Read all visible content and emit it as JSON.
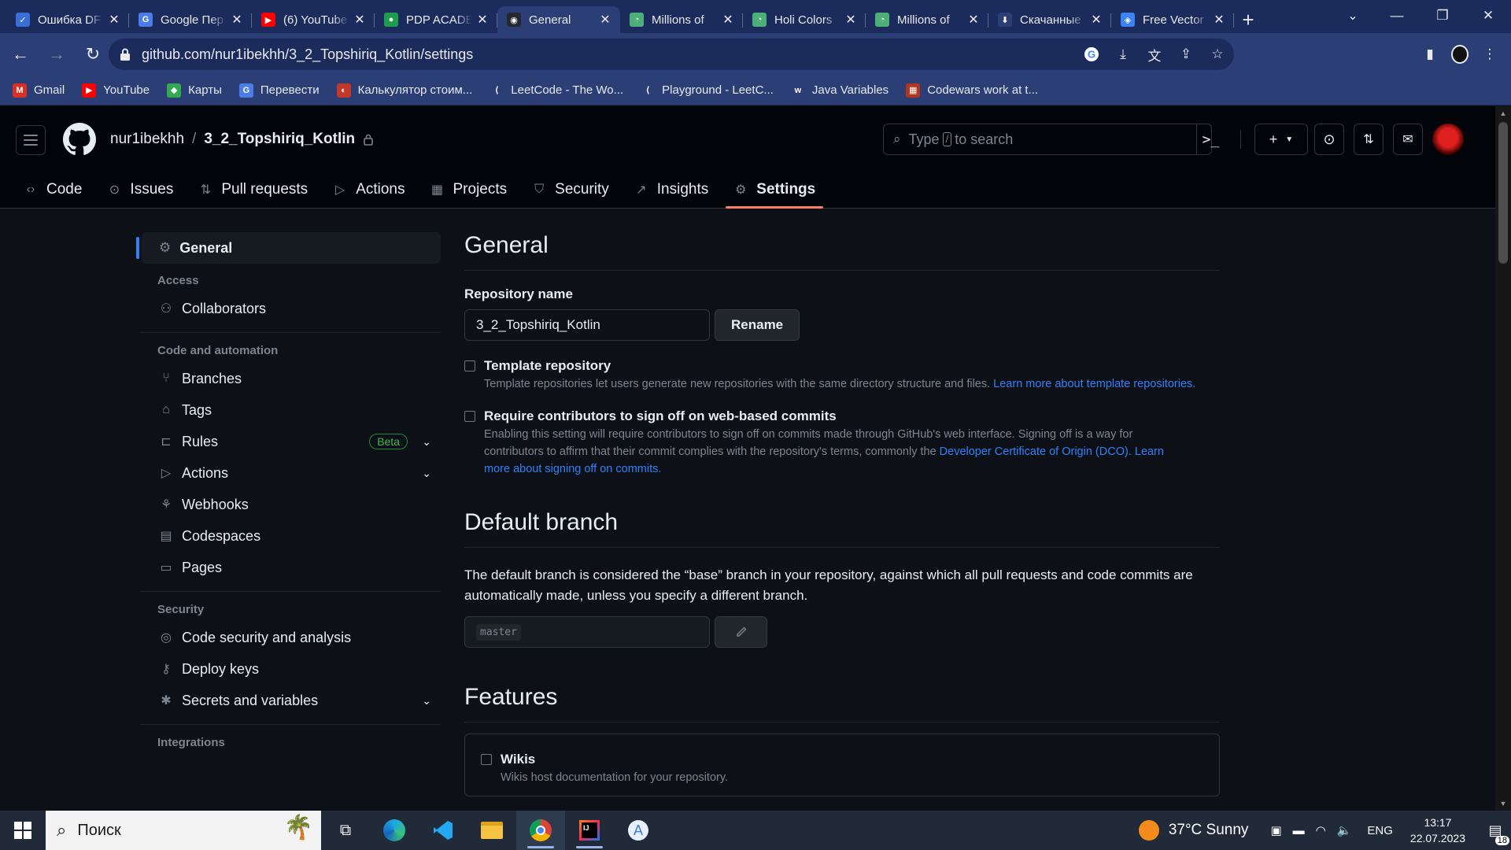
{
  "browser": {
    "tabs": [
      {
        "label": "Ошибка DF",
        "fav_color": "#3b6fd8",
        "fav_text": "✓"
      },
      {
        "label": "Google Пер",
        "fav_color": "#4a7de8",
        "fav_text": "G"
      },
      {
        "label": "(6) YouTube",
        "fav_color": "#ff0000",
        "fav_text": "▶"
      },
      {
        "label": "PDP ACADE",
        "fav_color": "#1d9d4d",
        "fav_text": "●"
      },
      {
        "label": "General",
        "fav_color": "#24292f",
        "fav_text": "◉"
      },
      {
        "label": "Millions of",
        "fav_color": "#4caf78",
        "fav_text": "◔"
      },
      {
        "label": "Holi Colors",
        "fav_color": "#4caf78",
        "fav_text": "◔"
      },
      {
        "label": "Millions of",
        "fav_color": "#4caf78",
        "fav_text": "◔"
      },
      {
        "label": "Скачанные",
        "fav_color": "#2c3e76",
        "fav_text": "⬇"
      },
      {
        "label": "Free Vector",
        "fav_color": "#3b82f6",
        "fav_text": "◈"
      }
    ],
    "active_tab_index": 4,
    "url": "github.com/nur1ibekhh/3_2_Topshiriq_Kotlin/settings",
    "bookmarks": [
      {
        "label": "Gmail",
        "color": "#d93025",
        "icon": "M"
      },
      {
        "label": "YouTube",
        "color": "#ff0000",
        "icon": "▶"
      },
      {
        "label": "Карты",
        "color": "#34a853",
        "icon": "◆"
      },
      {
        "label": "Перевести",
        "color": "#4a7de8",
        "icon": "G"
      },
      {
        "label": "Калькулятор стоим...",
        "color": "#c0392b",
        "icon": "◐"
      },
      {
        "label": "LeetCode - The Wo...",
        "color": "#2c3e76",
        "icon": "⟨"
      },
      {
        "label": "Playground - LeetC...",
        "color": "#2c3e76",
        "icon": "⟨"
      },
      {
        "label": "Java Variables",
        "color": "#2c3e76",
        "icon": "w"
      },
      {
        "label": "Codewars work at t...",
        "color": "#b1361e",
        "icon": "▦"
      }
    ]
  },
  "github": {
    "owner": "nur1ibekhh",
    "repo": "3_2_Topshiriq_Kotlin",
    "search_placeholder_pre": "Type",
    "search_key": "/",
    "search_placeholder_post": "to search",
    "repo_nav": [
      {
        "label": "Code",
        "icon": "code-icon",
        "glyph": "‹›"
      },
      {
        "label": "Issues",
        "icon": "issue-icon",
        "glyph": "⊙"
      },
      {
        "label": "Pull requests",
        "icon": "pull-request-icon",
        "glyph": "⇅"
      },
      {
        "label": "Actions",
        "icon": "play-icon",
        "glyph": "▷"
      },
      {
        "label": "Projects",
        "icon": "table-icon",
        "glyph": "▦"
      },
      {
        "label": "Security",
        "icon": "shield-icon",
        "glyph": "⛉"
      },
      {
        "label": "Insights",
        "icon": "graph-icon",
        "glyph": "↗"
      },
      {
        "label": "Settings",
        "icon": "gear-icon",
        "glyph": "⚙"
      }
    ],
    "selected_nav": "Settings"
  },
  "sidebar": {
    "general": "General",
    "groups": [
      {
        "heading": "Access",
        "items": [
          {
            "label": "Collaborators",
            "icon": "people-icon",
            "glyph": "⚇"
          }
        ]
      },
      {
        "heading": "Code and automation",
        "items": [
          {
            "label": "Branches",
            "icon": "git-branch-icon",
            "glyph": "⑂"
          },
          {
            "label": "Tags",
            "icon": "tag-icon",
            "glyph": "⌂"
          },
          {
            "label": "Rules",
            "icon": "repo-push-icon",
            "glyph": "⊏",
            "badge": "Beta",
            "chevron": true
          },
          {
            "label": "Actions",
            "icon": "play-icon",
            "glyph": "▷",
            "chevron": true
          },
          {
            "label": "Webhooks",
            "icon": "webhook-icon",
            "glyph": "⚘"
          },
          {
            "label": "Codespaces",
            "icon": "codespaces-icon",
            "glyph": "▤"
          },
          {
            "label": "Pages",
            "icon": "browser-icon",
            "glyph": "▭"
          }
        ]
      },
      {
        "heading": "Security",
        "items": [
          {
            "label": "Code security and analysis",
            "icon": "codescan-icon",
            "glyph": "◎"
          },
          {
            "label": "Deploy keys",
            "icon": "key-icon",
            "glyph": "⚷"
          },
          {
            "label": "Secrets and variables",
            "icon": "asterisk-icon",
            "glyph": "✱",
            "chevron": true
          }
        ]
      },
      {
        "heading": "Integrations",
        "items": []
      }
    ]
  },
  "settings": {
    "title": "General",
    "repo_name_label": "Repository name",
    "repo_name_value": "3_2_Topshiriq_Kotlin",
    "rename_button": "Rename",
    "template": {
      "title": "Template repository",
      "desc": "Template repositories let users generate new repositories with the same directory structure and files.",
      "link": "Learn more about template repositories."
    },
    "signoff": {
      "title": "Require contributors to sign off on web-based commits",
      "desc": "Enabling this setting will require contributors to sign off on commits made through GitHub's web interface. Signing off is a way for contributors to affirm that their commit complies with the repository's terms, commonly the",
      "link1": "Developer Certificate of Origin (DCO).",
      "link2": "Learn more about signing off on commits."
    },
    "default_branch": {
      "title": "Default branch",
      "desc": "The default branch is considered the “base” branch in your repository, against which all pull requests and code commits are automatically made, unless you specify a different branch.",
      "value": "master"
    },
    "features": {
      "title": "Features",
      "wikis_title": "Wikis",
      "wikis_desc": "Wikis host documentation for your repository."
    }
  },
  "taskbar": {
    "search_placeholder": "Поиск",
    "weather": "37°C  Sunny",
    "lang": "ENG",
    "time": "13:17",
    "date": "22.07.2023",
    "notifications": "18"
  }
}
